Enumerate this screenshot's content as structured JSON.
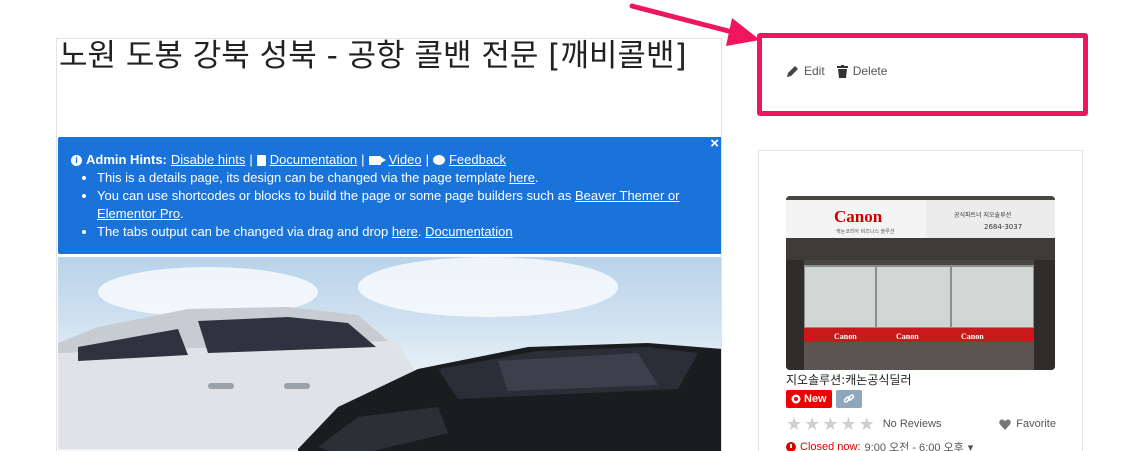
{
  "main": {
    "title": "노원 도봉 강북 성북 - 공항 콜밴 전문 [깨비콜밴]",
    "hints": {
      "label": "Admin Hints:",
      "disable": "Disable hints",
      "separator": "|",
      "documentation": "Documentation",
      "video": "Video",
      "feedback": "Feedback",
      "close": "×",
      "bullets": [
        {
          "text": "This is a details page, its design can be changed via the page template ",
          "link": "here",
          "after": "."
        },
        {
          "text": "You can use shortcodes or blocks to build the page or some page builders such as ",
          "link": "Beaver Themer or Elementor Pro",
          "after": "."
        },
        {
          "text": "The tabs output can be changed via drag and drop ",
          "link": "here",
          "after": ". ",
          "link2": "Documentation"
        }
      ]
    }
  },
  "toolbar": {
    "edit_label": "Edit",
    "delete_label": "Delete",
    "highlight_color": "#f0165e"
  },
  "listing": {
    "photo_sign_brand": "Canon",
    "photo_sign_text": "공식파트너 지오솔루션",
    "photo_sign_phone": "2684-3037",
    "photo_sub_text": "캐논코리아 비즈니스 솔루션",
    "name": "지오솔루션:캐논공식딜러",
    "badge_new": "New",
    "reviews": "No Reviews",
    "favorite": "Favorite",
    "closed_label": "Closed now:",
    "hours": "9:00 오전 - 6:00 오후",
    "hours_caret": "▾",
    "stars": [
      "★",
      "★",
      "★",
      "★",
      "★"
    ]
  },
  "colors": {
    "hints_bg": "#1a73d9",
    "new_badge": "#e00000",
    "link_badge": "#8fa7bd"
  }
}
